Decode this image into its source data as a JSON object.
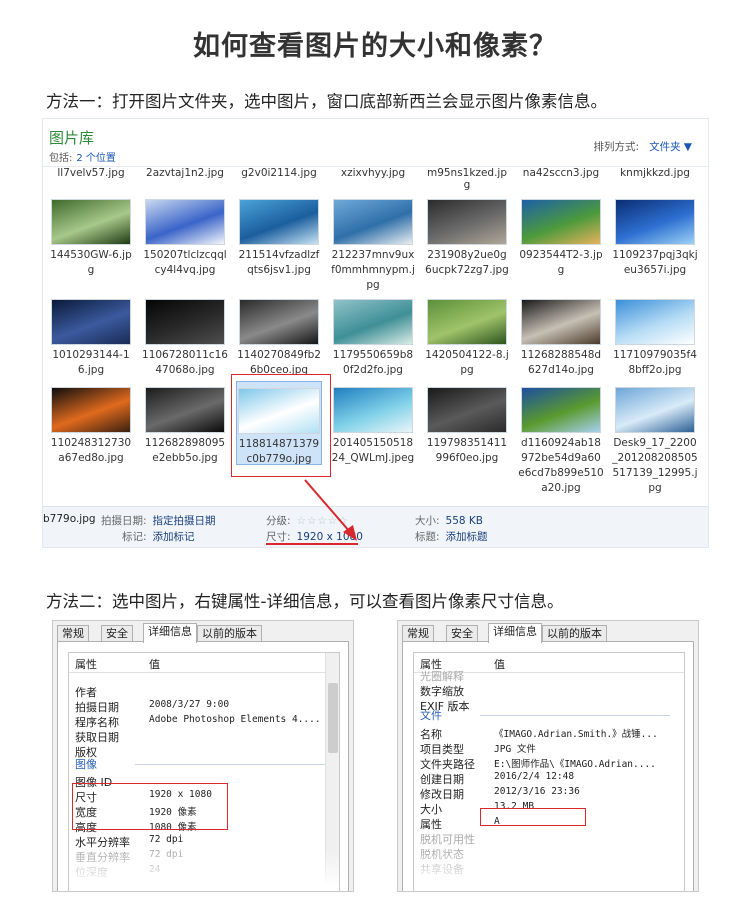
{
  "page": {
    "title": "如何查看图片的大小和像素？",
    "method1": "方法一：打开图片文件夹，选中图片，窗口底部新西兰会显示图片像素信息。",
    "method2": "方法二：选中图片，右键属性-详细信息，可以查看图片像素尺寸信息。"
  },
  "library": {
    "title": "图片库",
    "includes_label": "包括:",
    "includes_link": "2 个位置",
    "sort_label": "排列方式:",
    "sort_value": "文件夹 ▼",
    "top_row": [
      "ll7velv57.jpg",
      "2azvtaj1n2.jpg",
      "g2v0i2114.jpg",
      "xzixvhyy.jpg",
      "m95ns1kzed.jp",
      "na42sccn3.jpg",
      "knmjkkzd.jpg"
    ],
    "top_row_extra": "g",
    "rows": [
      [
        {
          "name": "144530GW-6.jpg",
          "colors": [
            "#3f6a2c",
            "#a7c98a",
            "#1f3a14"
          ]
        },
        {
          "name": "150207tlclzcqqlcy4l4vq.jpg",
          "colors": [
            "#c8d8f0",
            "#3a64c8",
            "#f3f6fb"
          ]
        },
        {
          "name": "211514vfzadlzfqts6jsv1.jpg",
          "colors": [
            "#4aa3d8",
            "#1b5e9e",
            "#c7e3f3"
          ]
        },
        {
          "name": "212237mnv9uxf0mmhmnypm.jpg",
          "colors": [
            "#6fa9d9",
            "#2f6fa8",
            "#e9eef2"
          ]
        },
        {
          "name": "231908y2ue0g6ucpk72zg7.jpg",
          "colors": [
            "#2b2b2b",
            "#6b6b6b",
            "#b0a898"
          ]
        },
        {
          "name": "0923544T2-3.jpg",
          "colors": [
            "#1d5fa8",
            "#4c9a3c",
            "#e7b25a"
          ]
        },
        {
          "name": "1109237pqj3qkjeu3657i.jpg",
          "colors": [
            "#0b2d73",
            "#2d6fd1",
            "#9dd2f5"
          ]
        }
      ],
      [
        {
          "name": "1010293144-16.jpg",
          "colors": [
            "#0a1a3a",
            "#3b5a9e",
            "#1a2b55"
          ]
        },
        {
          "name": "1106728011c1647068o.jpg",
          "colors": [
            "#050505",
            "#2a2a2a",
            "#4e4e4e"
          ]
        },
        {
          "name": "1140270849fb26b0ceo.jpg",
          "colors": [
            "#2a2a2a",
            "#8a8a8a",
            "#151515"
          ]
        },
        {
          "name": "1179550659b80f2d2fo.jpg",
          "colors": [
            "#8fc3c8",
            "#3f8f97",
            "#d8ece6"
          ]
        },
        {
          "name": "1420504122-8.jpg",
          "colors": [
            "#5c8f3a",
            "#9fc46a",
            "#2e5420"
          ]
        },
        {
          "name": "11268288548d627d14o.jpg",
          "colors": [
            "#1a1a1a",
            "#c7c0b5",
            "#4a3a2a"
          ]
        },
        {
          "name": "11710979035f48bff2o.jpg",
          "colors": [
            "#3b8fd9",
            "#b6dcf5",
            "#ffffff"
          ]
        }
      ],
      [
        {
          "name": "110248312730a67ed8o.jpg",
          "colors": [
            "#0e0e0e",
            "#e06a1e",
            "#3a2010"
          ]
        },
        {
          "name": "112682898095e2ebb5o.jpg",
          "colors": [
            "#1c1c1c",
            "#6a6a6a",
            "#0a0a0a"
          ]
        },
        {
          "name": "118814871379c0b779o.jpg",
          "colors": [
            "#7fc7ea",
            "#ffffff",
            "#b0e0f4"
          ]
        },
        {
          "name": "20140515051824_QWLmJ.jpeg",
          "colors": [
            "#1f7fbf",
            "#7fd0e8",
            "#e9f5f8"
          ]
        },
        {
          "name": "119798351411996f0eo.jpg",
          "colors": [
            "#1a1a1a",
            "#5a5a5a",
            "#2a2a2a"
          ]
        },
        {
          "name": "d1160924ab18972be54d9a60e6cd7b899e510a20.jpg",
          "colors": [
            "#1c4fa0",
            "#5a9a2e",
            "#a8d0f0"
          ]
        },
        {
          "name": "Desk9_17_2200_201208208505517139_12995.jpg",
          "colors": [
            "#6ea6d8",
            "#d8ebf8",
            "#2b5f96"
          ]
        }
      ]
    ],
    "details": {
      "filename": "b779o.jpg",
      "date_label": "拍摄日期:",
      "date_value": "指定拍摄日期",
      "tags_label": "标记:",
      "tags_value": "添加标记",
      "rating_label": "分级:",
      "rating_stars": "☆☆☆☆☆",
      "dimensions_label": "尺寸:",
      "dimensions_value": "1920 x 1080",
      "size_label": "大小:",
      "size_value": "558 KB",
      "title_label": "标题:",
      "title_value": "添加标题"
    }
  },
  "dialog_common": {
    "tabs": [
      "常规",
      "安全",
      "详细信息",
      "以前的版本"
    ],
    "col_property": "属性",
    "col_value": "值"
  },
  "dialog1": {
    "rows_top": [
      {
        "k": "作者",
        "v": ""
      },
      {
        "k": "拍摄日期",
        "v": "2008/3/27 9:00"
      },
      {
        "k": "程序名称",
        "v": "Adobe Photoshop Elements 4...."
      },
      {
        "k": "获取日期",
        "v": ""
      },
      {
        "k": "版权",
        "v": ""
      }
    ],
    "group": "图像",
    "rows_bottom": [
      {
        "k": "图像 ID",
        "v": ""
      },
      {
        "k": "尺寸",
        "v": "1920 x 1080"
      },
      {
        "k": "宽度",
        "v": "1920 像素"
      },
      {
        "k": "高度",
        "v": "1080 像素"
      },
      {
        "k": "水平分辨率",
        "v": "72 dpi"
      },
      {
        "k": "垂直分辨率",
        "v": "72 dpi"
      },
      {
        "k": "位深度",
        "v": "24"
      }
    ]
  },
  "dialog2": {
    "rows_top": [
      {
        "k": "光圈解释",
        "v": ""
      },
      {
        "k": "数字缩放",
        "v": ""
      },
      {
        "k": "EXIF 版本",
        "v": ""
      }
    ],
    "group": "文件",
    "rows_bottom": [
      {
        "k": "名称",
        "v": "《IMAGO.Adrian.Smith.》战锤..."
      },
      {
        "k": "项目类型",
        "v": "JPG 文件"
      },
      {
        "k": "文件夹路径",
        "v": "E:\\图师作品\\《IMAGO.Adrian...."
      },
      {
        "k": "创建日期",
        "v": "2016/2/4 12:48"
      },
      {
        "k": "修改日期",
        "v": "2012/3/16 23:36"
      },
      {
        "k": "大小",
        "v": "13.2 MB"
      },
      {
        "k": "属性",
        "v": "A"
      },
      {
        "k": "脱机可用性",
        "v": ""
      },
      {
        "k": "脱机状态",
        "v": ""
      },
      {
        "k": "共享设备",
        "v": ""
      }
    ]
  }
}
